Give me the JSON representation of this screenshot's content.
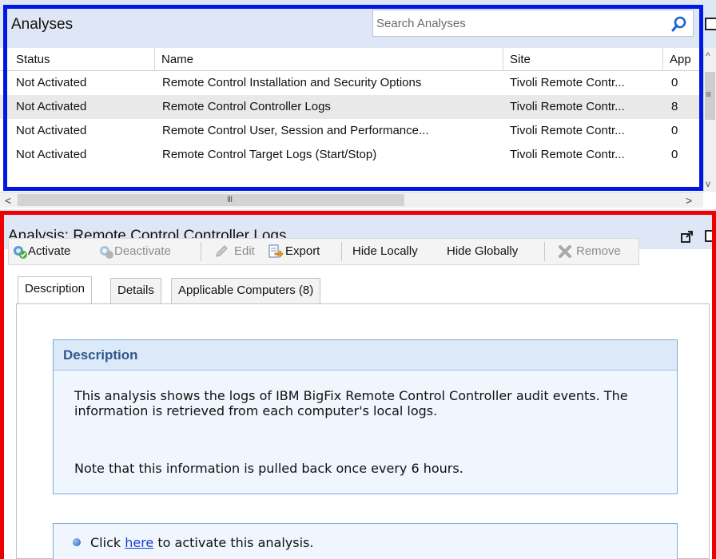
{
  "analyses_panel": {
    "title": "Analyses",
    "search_placeholder": "Search Analyses",
    "columns": [
      "Status",
      "Name",
      "Site",
      "App"
    ],
    "rows": [
      {
        "status": "Not Activated",
        "name": "Remote Control Installation and Security Options",
        "site": "Tivoli Remote Contr...",
        "app": "0"
      },
      {
        "status": "Not Activated",
        "name": "Remote Control Controller Logs",
        "site": "Tivoli Remote Contr...",
        "app": "8"
      },
      {
        "status": "Not Activated",
        "name": "Remote Control User, Session and Performance...",
        "site": "Tivoli Remote Contr...",
        "app": "0"
      },
      {
        "status": "Not Activated",
        "name": "Remote Control Target Logs (Start/Stop)",
        "site": "Tivoli Remote Contr...",
        "app": "0"
      }
    ],
    "selected_row": 1
  },
  "detail_panel": {
    "title": "Analysis: Remote Control Controller Logs",
    "toolbar": {
      "activate": "Activate",
      "deactivate": "Deactivate",
      "edit": "Edit",
      "export": "Export",
      "hide_locally": "Hide Locally",
      "hide_globally": "Hide Globally",
      "remove": "Remove"
    },
    "tabs": [
      "Description",
      "Details",
      "Applicable Computers (8)"
    ],
    "active_tab": 0,
    "description": {
      "heading": "Description",
      "body": "This analysis shows the logs of IBM BigFix Remote Control Controller audit events. The information is retrieved from each computer's local logs.",
      "note": "Note that this information is pulled back once every 6 hours."
    },
    "activation": {
      "prefix": "Click",
      "link": "here",
      "suffix": "to activate this analysis."
    }
  },
  "colors": {
    "header_bg": "#dfe7f6",
    "highlight_blue": "#0018e6",
    "highlight_red": "#ee0000",
    "desc_heading": "#2f5a8c",
    "link": "#1a3fd6"
  },
  "icons": [
    "search-icon",
    "activate-icon",
    "deactivate-icon",
    "edit-icon",
    "export-icon",
    "remove-icon",
    "popout-icon",
    "bullet-icon"
  ]
}
